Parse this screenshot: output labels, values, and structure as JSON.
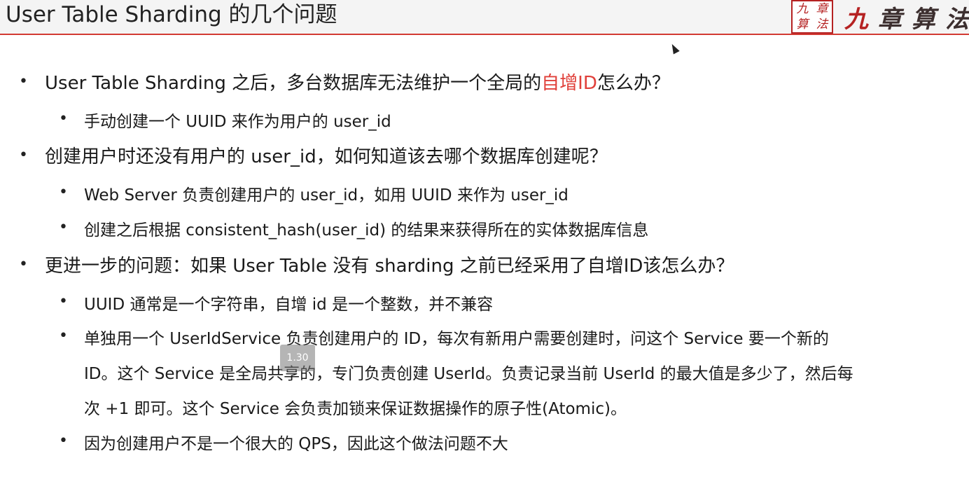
{
  "title": "User Table Sharding 的几个问题",
  "logo": {
    "seal_chars": [
      "九",
      "章",
      "算",
      "法"
    ],
    "brand_first": "九",
    "brand_rest": "章算法"
  },
  "bullets": [
    {
      "level": 1,
      "pre": "User Table Sharding 之后，多台数据库无法维护一个全局的",
      "highlight": "自增ID",
      "post": "怎么办？"
    },
    {
      "level": 2,
      "text": "手动创建一个 UUID 来作为用户的 user_id"
    },
    {
      "level": 1,
      "text": "创建用户时还没有用户的 user_id，如何知道该去哪个数据库创建呢？"
    },
    {
      "level": 2,
      "text": "Web Server 负责创建用户的 user_id，如用 UUID 来作为 user_id"
    },
    {
      "level": 2,
      "text": "创建之后根据 consistent_hash(user_id) 的结果来获得所在的实体数据库信息"
    },
    {
      "level": 1,
      "text": "更进一步的问题：如果 User Table 没有 sharding 之前已经采用了自增ID该怎么办？"
    },
    {
      "level": 2,
      "text": "UUID 通常是一个字符串，自增 id 是一个整数，并不兼容"
    },
    {
      "level": 2,
      "lines": [
        "单独用一个 UserIdService 负责创建用户的 ID，每次有新用户需要创建时，问这个 Service 要一个新的",
        "ID。这个 Service 是全局共享的，专门负责创建 UserId。负责记录当前 UserId 的最大值是多少了，然后每",
        "次 +1 即可。这个 Service 会负责加锁来保证数据操作的原子性(Atomic)。"
      ]
    },
    {
      "level": 2,
      "text": "因为创建用户不是一个很大的 QPS，因此这个做法问题不大"
    }
  ],
  "bullet_symbol": "•",
  "overlay_badge": "1.30"
}
